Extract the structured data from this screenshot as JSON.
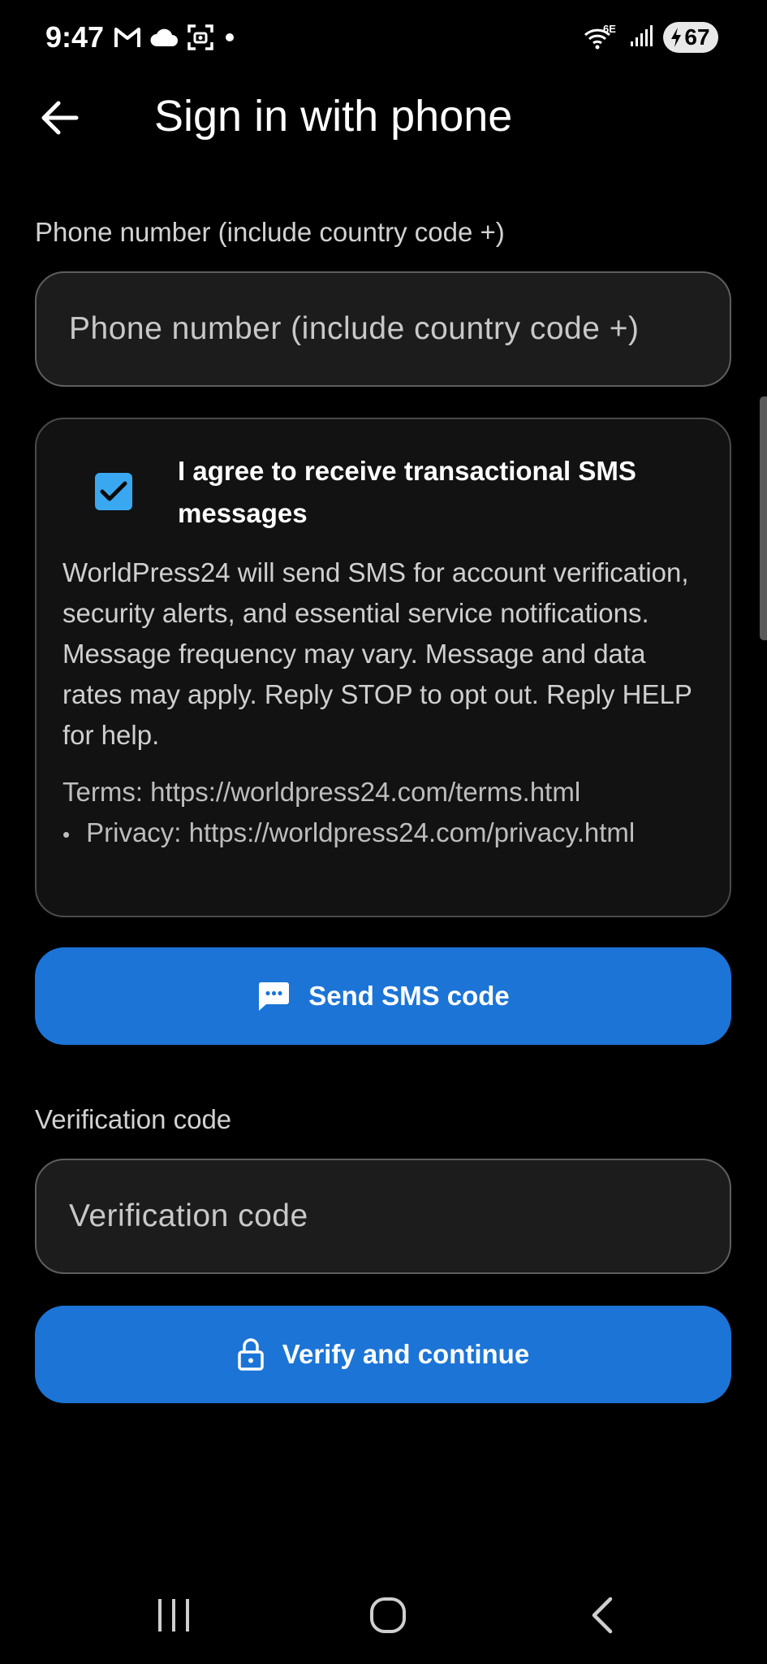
{
  "status_bar": {
    "time": "9:47",
    "left_icons": [
      "gmail-icon",
      "cloud-icon",
      "screenshot-icon",
      "dot-icon"
    ],
    "right_icons": [
      "wifi-6e-icon",
      "signal-icon",
      "battery-charging-icon"
    ],
    "wifi_badge": "6E",
    "battery_level": "67"
  },
  "app_bar": {
    "back_icon": "arrow-left-icon",
    "title": "Sign in with phone"
  },
  "phone": {
    "label": "Phone number (include country code +)",
    "placeholder": "Phone number (include country code +)",
    "value": ""
  },
  "consent": {
    "checked": true,
    "title": "I agree to receive transactional SMS messages",
    "body": "WorldPress24 will send SMS for account verification, security alerts, and essential service notifications. Message frequency may vary. Message and data rates may apply. Reply STOP to opt out. Reply HELP for help.",
    "terms": "Terms: https://worldpress24.com/terms.html",
    "separator": "•",
    "privacy": "Privacy: https://worldpress24.com/privacy.html"
  },
  "send_button": {
    "icon": "sms-icon",
    "label": "Send SMS code"
  },
  "verification": {
    "label": "Verification code",
    "placeholder": "Verification code",
    "value": ""
  },
  "verify_button": {
    "icon": "lock-icon",
    "label": "Verify and continue"
  },
  "nav_bar": {
    "icons": [
      "recents-icon",
      "home-icon",
      "back-icon"
    ]
  },
  "colors": {
    "background": "#000000",
    "primary": "#1c74d6",
    "checkbox": "#3aa8f0",
    "field_background": "#1c1c1c",
    "field_border": "#5e5e5e"
  }
}
